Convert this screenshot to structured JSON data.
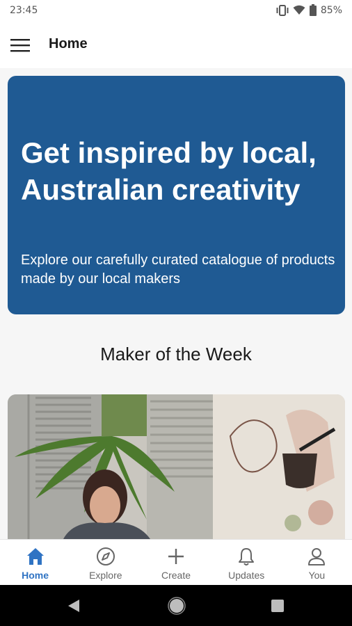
{
  "status_bar": {
    "time": "23:45",
    "battery": "85%"
  },
  "app_bar": {
    "title": "Home"
  },
  "hero": {
    "title": "Get inspired by local, Australian creativity",
    "subtitle": "Explore our carefully curated catalogue of products made by our local makers",
    "background_color": "#1f5a93"
  },
  "section": {
    "title": "Maker of the Week"
  },
  "bottom_nav": {
    "items": [
      {
        "label": "Home",
        "icon": "home-icon",
        "active": true
      },
      {
        "label": "Explore",
        "icon": "compass-icon",
        "active": false
      },
      {
        "label": "Create",
        "icon": "plus-icon",
        "active": false
      },
      {
        "label": "Updates",
        "icon": "bell-icon",
        "active": false
      },
      {
        "label": "You",
        "icon": "person-icon",
        "active": false
      }
    ],
    "active_color": "#2f73c3"
  }
}
